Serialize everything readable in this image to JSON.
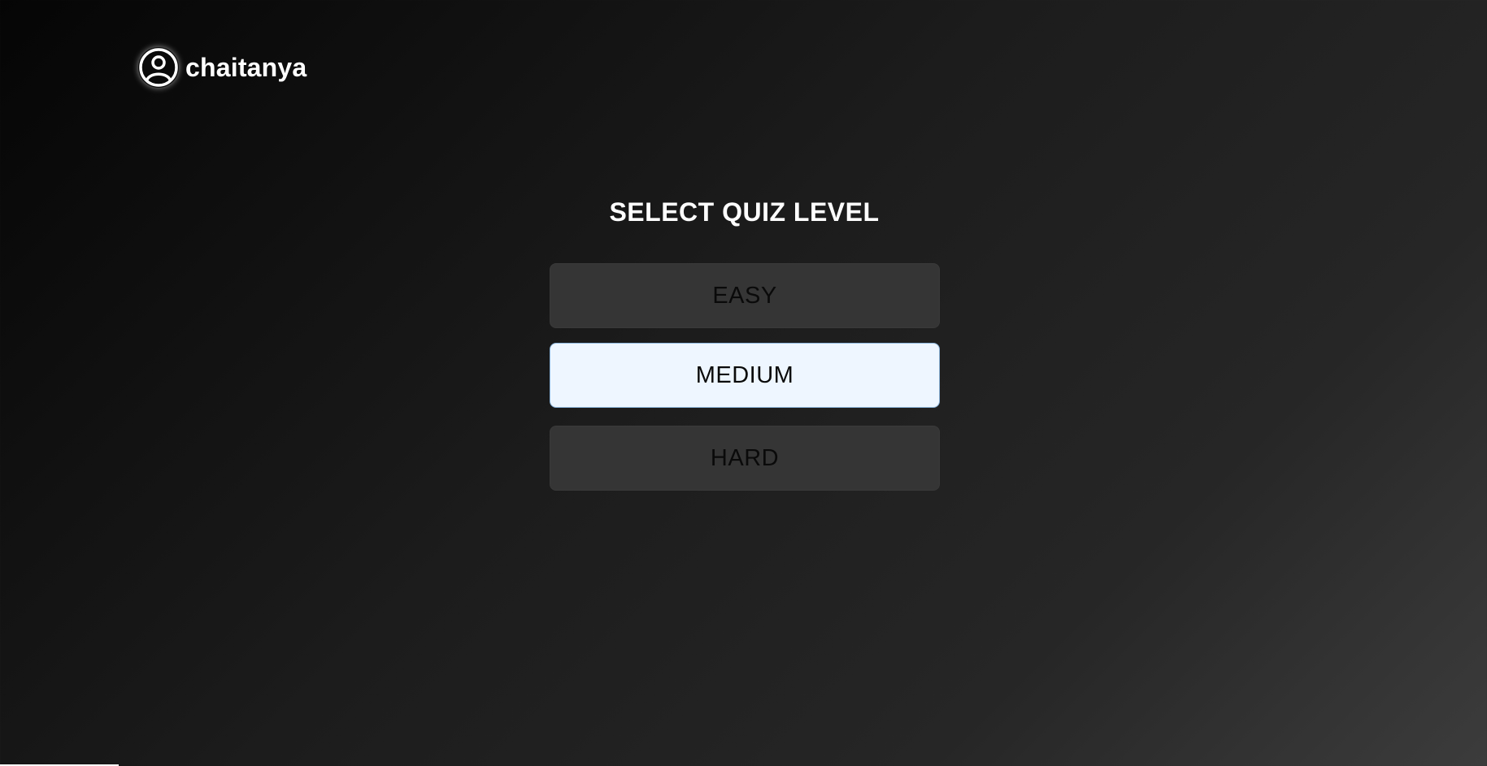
{
  "user": {
    "name": "chaitanya",
    "avatar_icon": "user-circle-icon"
  },
  "quiz": {
    "title": "SELECT QUIZ LEVEL",
    "levels": [
      {
        "label": "EASY",
        "selected": false
      },
      {
        "label": "MEDIUM",
        "selected": true
      },
      {
        "label": "HARD",
        "selected": false
      }
    ]
  },
  "colors": {
    "selected_bg": "#eef6ff",
    "button_bg": "#353535",
    "selected_border": "#8fb8de"
  }
}
